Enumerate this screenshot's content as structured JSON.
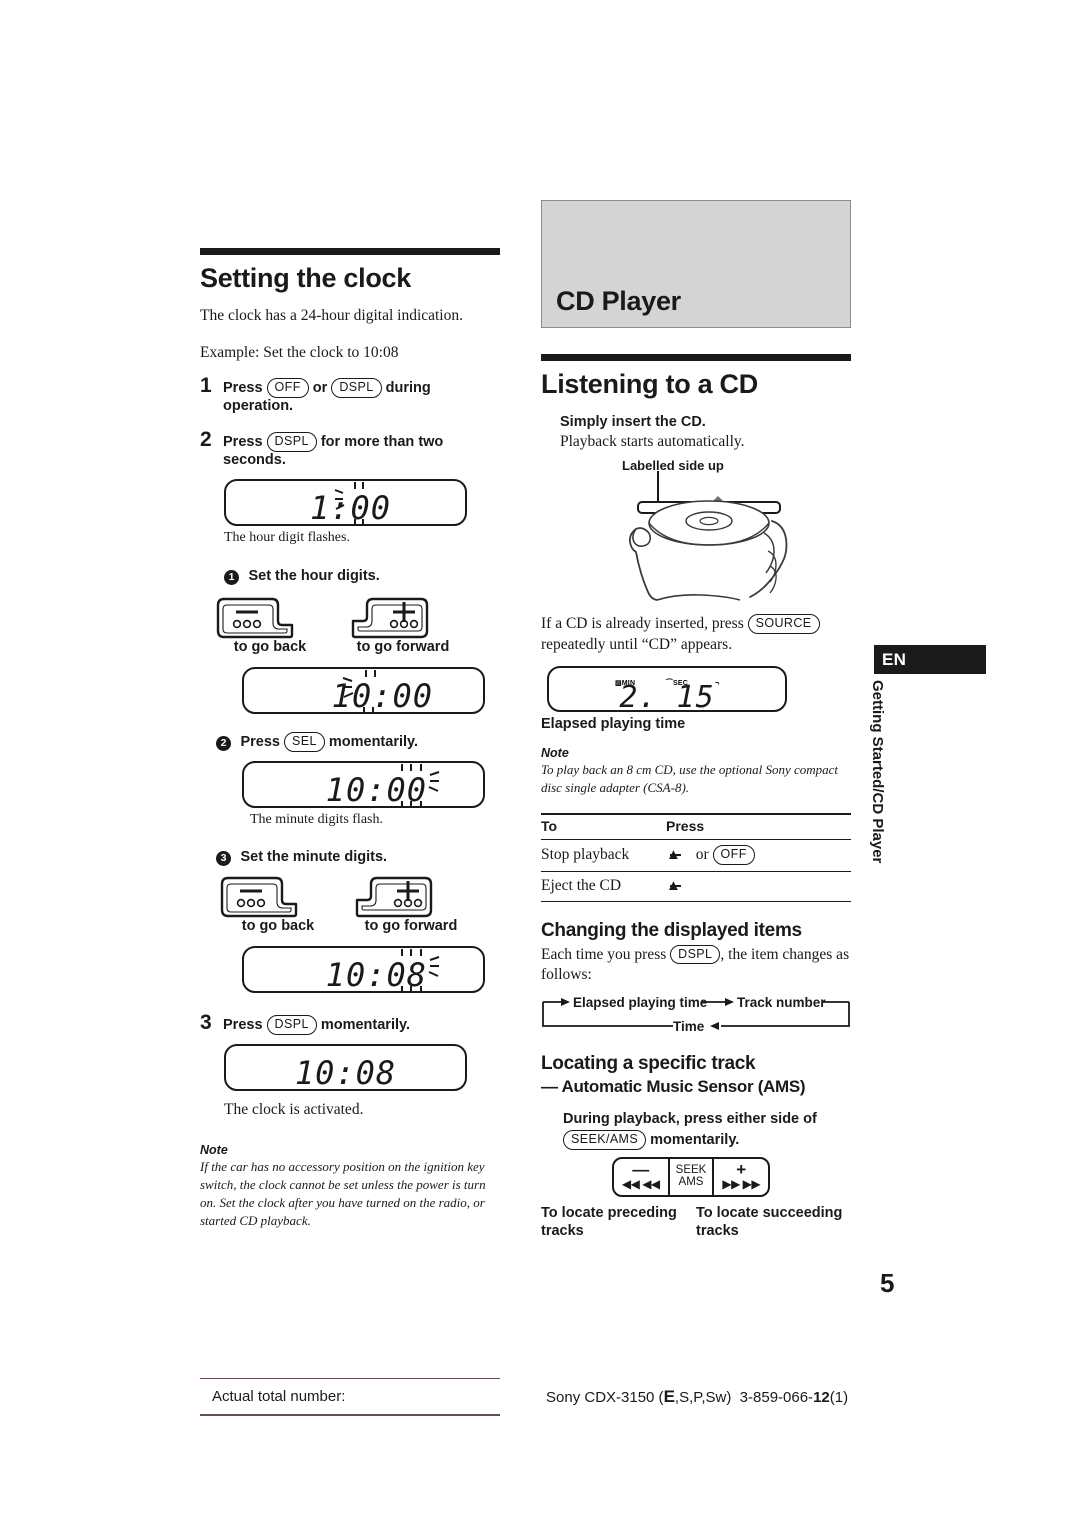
{
  "document": {
    "page_number": "5",
    "language_tab": "EN",
    "side_tab_text": "Getting Started/CD Player",
    "footer_left_label": "Actual total number:",
    "footer_right": {
      "brand_model": "Sony CDX-3150 (",
      "variant_bold": "E",
      "variant_rest": ",S,P,Sw)",
      "part_number_prefix": "3-859-066-",
      "part_number_bold": "12",
      "part_number_suffix": "(1)"
    }
  },
  "left_column": {
    "heading": "Setting the clock",
    "intro": "The clock has a 24-hour digital indication.",
    "example": "Example: Set the clock to 10:08",
    "steps": [
      {
        "num": "1",
        "text_parts": [
          "Press",
          "or",
          "during operation."
        ],
        "keys": [
          "OFF",
          "DSPL"
        ]
      },
      {
        "num": "2",
        "text_parts": [
          "Press",
          "for more than two seconds."
        ],
        "keys": [
          "DSPL"
        ]
      },
      {
        "num": "3",
        "text_parts": [
          "Press",
          "momentarily."
        ],
        "keys": [
          "DSPL"
        ]
      }
    ],
    "display_1": {
      "value": "1:00",
      "caption": "The hour digit flashes."
    },
    "substep_1": {
      "marker": "1",
      "label": "Set the hour digits."
    },
    "rocker_labels": {
      "back": "to go back",
      "forward": "to go forward"
    },
    "rocker_symbols": {
      "minus": "—",
      "plus": "+"
    },
    "display_2": {
      "value": "10:00"
    },
    "substep_2": {
      "marker": "2",
      "text_before": "Press",
      "key": "SEL",
      "text_after": "momentarily."
    },
    "display_3": {
      "value": "10:00",
      "caption": "The minute digits flash."
    },
    "substep_3": {
      "marker": "3",
      "label": "Set the minute digits."
    },
    "display_4": {
      "value": "10:08"
    },
    "display_5": {
      "value": "10:08",
      "caption": "The clock is activated."
    },
    "note": {
      "label": "Note",
      "body": "If the car has no accessory position on the ignition key switch, the clock cannot be set unless the power is turn on. Set the clock after you have turned on the radio, or started CD playback."
    }
  },
  "right_column": {
    "section_banner": "CD Player",
    "heading": "Listening to a CD",
    "insert": {
      "title": "Simply insert the CD.",
      "subtitle": "Playback starts automatically.",
      "callout": "Labelled side up"
    },
    "already_inserted": {
      "text_before": "If a CD is already inserted, press",
      "key": "SOURCE",
      "text_after": "repeatedly until “CD” appears."
    },
    "display_time": {
      "min_label": "MIN",
      "sec_label": "SEC",
      "value": "2. 15",
      "caption": "Elapsed playing time"
    },
    "note": {
      "label": "Note",
      "body": "To play back an 8 cm CD, use the optional Sony compact disc single adapter (CSA-8)."
    },
    "table": {
      "headers": [
        "To",
        "Press"
      ],
      "rows": [
        {
          "to": "Stop playback",
          "press_icon": "▲",
          "press_text": "or",
          "press_key": "OFF"
        },
        {
          "to": "Eject the CD",
          "press_icon": "▲",
          "press_text": "",
          "press_key": ""
        }
      ]
    },
    "changing_items": {
      "heading": "Changing the displayed items",
      "text_before": "Each time you press",
      "key": "DSPL",
      "text_after": ", the item changes as follows:",
      "flow": [
        "Elapsed playing time",
        "Track number",
        "Time"
      ]
    },
    "locating": {
      "heading": "Locating a specific track",
      "subheading": "— Automatic Music Sensor (AMS)",
      "instruction_before": "During playback, press either side of",
      "key": "SEEK/AMS",
      "instruction_after": "momentarily.",
      "button": {
        "left_symbol": "—",
        "left_arrows": "◀◀ ◀◀",
        "mid_line1": "SEEK",
        "mid_line2": "AMS",
        "right_symbol": "+",
        "right_arrows": "▶▶ ▶▶"
      },
      "label_left": "To locate preceding tracks",
      "label_right": "To locate succeeding tracks"
    }
  }
}
